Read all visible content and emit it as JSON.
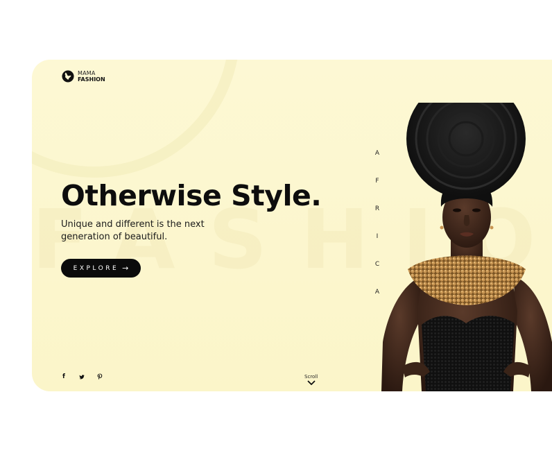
{
  "brand": {
    "top": "MAMA",
    "bottom": "FASHION",
    "icon": "globe-icon"
  },
  "hero": {
    "watermark": "FASHION",
    "headline": "Otherwise Style.",
    "subline": "Unique and different is the next generation of beautiful.",
    "cta_label": "EXPLORE",
    "cta_icon": "arrow-right-icon"
  },
  "vertical_letters": [
    "A",
    "F",
    "R",
    "I",
    "C",
    "A"
  ],
  "social": [
    {
      "icon": "facebook-icon",
      "glyph": "f"
    },
    {
      "icon": "twitter-icon",
      "glyph": "🐦"
    },
    {
      "icon": "pinterest-icon",
      "glyph": "P"
    }
  ],
  "scroll": {
    "label": "Scroll",
    "icon": "chevron-down-icon"
  },
  "colors": {
    "card_bg": "#fdf8d4",
    "button": "#0b0b0b",
    "text": "#0d0d0d"
  }
}
